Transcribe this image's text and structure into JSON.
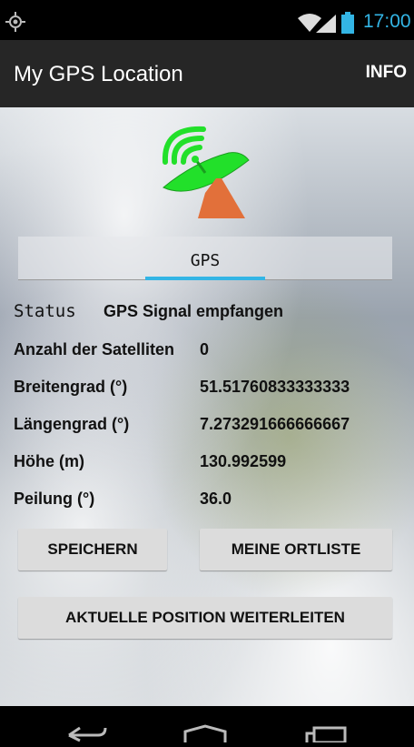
{
  "status_bar": {
    "time": "17:00",
    "icons": [
      "gps-icon",
      "wifi-icon",
      "signal-icon",
      "battery-icon"
    ],
    "time_color": "#33b5e5"
  },
  "action_bar": {
    "title": "My GPS Location",
    "info_label": "INFO"
  },
  "tabs": {
    "active_label": "GPS",
    "accent_color": "#33b5e5"
  },
  "status": {
    "label": "Status",
    "value": "GPS Signal empfangen"
  },
  "fields": [
    {
      "label": "Anzahl der Satelliten",
      "value": "0"
    },
    {
      "label": "Breitengrad (°)",
      "value": "51.51760833333333"
    },
    {
      "label": "Längengrad (°)",
      "value": "7.273291666666667"
    },
    {
      "label": "Höhe (m)",
      "value": "130.992599"
    },
    {
      "label": "Peilung (°)",
      "value": "36.0"
    }
  ],
  "buttons": {
    "save": "SPEICHERN",
    "my_list": "MEINE ORTLISTE",
    "share": "AKTUELLE POSITION WEITERLEITEN"
  },
  "nav_bar": {
    "icons": [
      "back-icon",
      "home-icon",
      "recent-apps-icon"
    ]
  },
  "logo": {
    "icon": "satellite-dish-icon",
    "dish_color": "#22e02a",
    "base_color": "#e2703a"
  }
}
